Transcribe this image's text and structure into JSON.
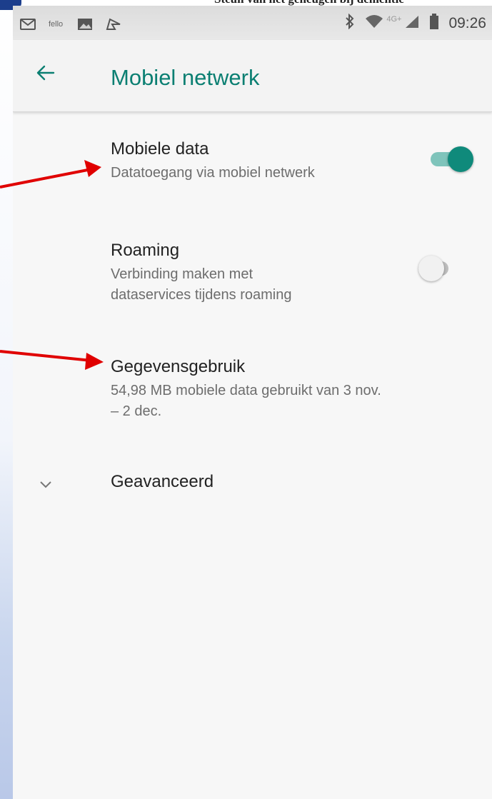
{
  "document": {
    "caption": "Steun van het geheugen bij dementie"
  },
  "status_bar": {
    "time": "09:26",
    "network": "4G+",
    "icons": [
      "gmail-icon",
      "fello-icon",
      "image-icon",
      "feedly-icon",
      "bluetooth-icon",
      "wifi-icon",
      "signal-icon",
      "battery-icon"
    ],
    "app_label": "fello"
  },
  "app_bar": {
    "title": "Mobiel netwerk",
    "back_icon": "arrow-left-icon"
  },
  "settings": {
    "mobile_data": {
      "title": "Mobiele data",
      "summary": "Datatoegang via mobiel netwerk",
      "enabled": true
    },
    "roaming": {
      "title": "Roaming",
      "summary_line1": "Verbinding maken met",
      "summary_line2": "dataservices tijdens roaming",
      "enabled": false
    },
    "data_usage": {
      "title": "Gegevensgebruik",
      "summary_line1": "54,98 MB mobiele data gebruikt van 3 nov.",
      "summary_line2": "– 2 dec."
    },
    "advanced": {
      "label": "Geavanceerd",
      "icon": "chevron-down-icon"
    }
  },
  "colors": {
    "accent": "#0b7f72",
    "toggle_on_track": "#7fc4bb",
    "toggle_on_thumb": "#0f8a7b",
    "toggle_off_track": "#bdbdbd",
    "toggle_off_thumb": "#f1f1f1",
    "annotation_arrow": "#e00000"
  }
}
